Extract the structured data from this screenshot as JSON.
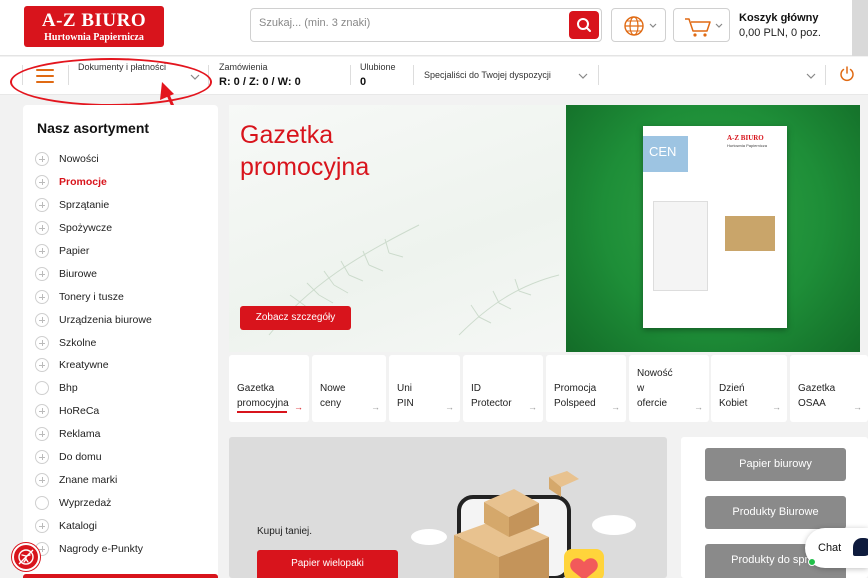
{
  "header": {
    "logo_title": "A-Z BIURO",
    "logo_subtitle": "Hurtownia Papiernicza",
    "search_placeholder": "Szukaj... (min. 3 znaki)",
    "cart_title": "Koszyk główny",
    "cart_summary": "0,00 PLN, 0 poz."
  },
  "subbar": {
    "documents_label": "Dokumenty i płatności",
    "orders_label": "Zamówienia",
    "orders_value": "R: 0 / Z: 0 / W: 0",
    "favorites_label": "Ulubione",
    "favorites_value": "0",
    "specialists_label": "Specjaliści do Twojej dyspozycji"
  },
  "sidebar": {
    "title": "Nasz asortyment",
    "items": [
      {
        "label": "Nowości",
        "active": false,
        "expandable": true
      },
      {
        "label": "Promocje",
        "active": true,
        "expandable": true
      },
      {
        "label": "Sprzątanie",
        "active": false,
        "expandable": true
      },
      {
        "label": "Spożywcze",
        "active": false,
        "expandable": true
      },
      {
        "label": "Papier",
        "active": false,
        "expandable": true
      },
      {
        "label": "Biurowe",
        "active": false,
        "expandable": true
      },
      {
        "label": "Tonery i tusze",
        "active": false,
        "expandable": true
      },
      {
        "label": "Urządzenia biurowe",
        "active": false,
        "expandable": true
      },
      {
        "label": "Szkolne",
        "active": false,
        "expandable": true
      },
      {
        "label": "Kreatywne",
        "active": false,
        "expandable": true
      },
      {
        "label": "Bhp",
        "active": false,
        "expandable": false
      },
      {
        "label": "HoReCa",
        "active": false,
        "expandable": true
      },
      {
        "label": "Reklama",
        "active": false,
        "expandable": true
      },
      {
        "label": "Do domu",
        "active": false,
        "expandable": true
      },
      {
        "label": "Znane marki",
        "active": false,
        "expandable": true
      },
      {
        "label": "Wyprzedaż",
        "active": false,
        "expandable": false
      },
      {
        "label": "Katalogi",
        "active": false,
        "expandable": true
      },
      {
        "label": "Nagrody e-Punkty",
        "active": false,
        "expandable": true
      }
    ]
  },
  "hero": {
    "title": "Gazetka promocyjna",
    "button_label": "Zobacz szczegóły",
    "catalog_brand": "A-Z BIURO",
    "catalog_subtitle": "Hurtownia Papiernicza",
    "catalog_banner": "CEN"
  },
  "tiles": [
    {
      "label": "Gazetka\npromocyjna",
      "active": true
    },
    {
      "label": "Nowe\nceny",
      "active": false
    },
    {
      "label": "Uni\nPIN",
      "active": false
    },
    {
      "label": "ID\nProtector",
      "active": false
    },
    {
      "label": "Promocja\nPolspeed",
      "active": false
    },
    {
      "label": "Nowość\nw\nofercie",
      "active": false
    },
    {
      "label": "Dzień\nKobiet",
      "active": false
    },
    {
      "label": "Gazetka\nOSAA",
      "active": false
    }
  ],
  "promo": {
    "text": "Kupuj taniej.",
    "button_label": "Papier wielopaki"
  },
  "right_panel": {
    "buttons": [
      "Papier biurowy",
      "Produkty Biurowe",
      "Produkty do sprzą"
    ]
  },
  "chat": {
    "label": "Chat"
  },
  "colors": {
    "brand_red": "#d8141c",
    "accent_orange": "#e06a13",
    "hero_green": "#1e8e38",
    "gray_button": "#8a8a8a"
  },
  "icons": [
    "search-icon",
    "globe-icon",
    "cart-icon",
    "menu-icon",
    "chevron-down-icon",
    "power-icon",
    "chat-icon",
    "accessibility-icon"
  ]
}
